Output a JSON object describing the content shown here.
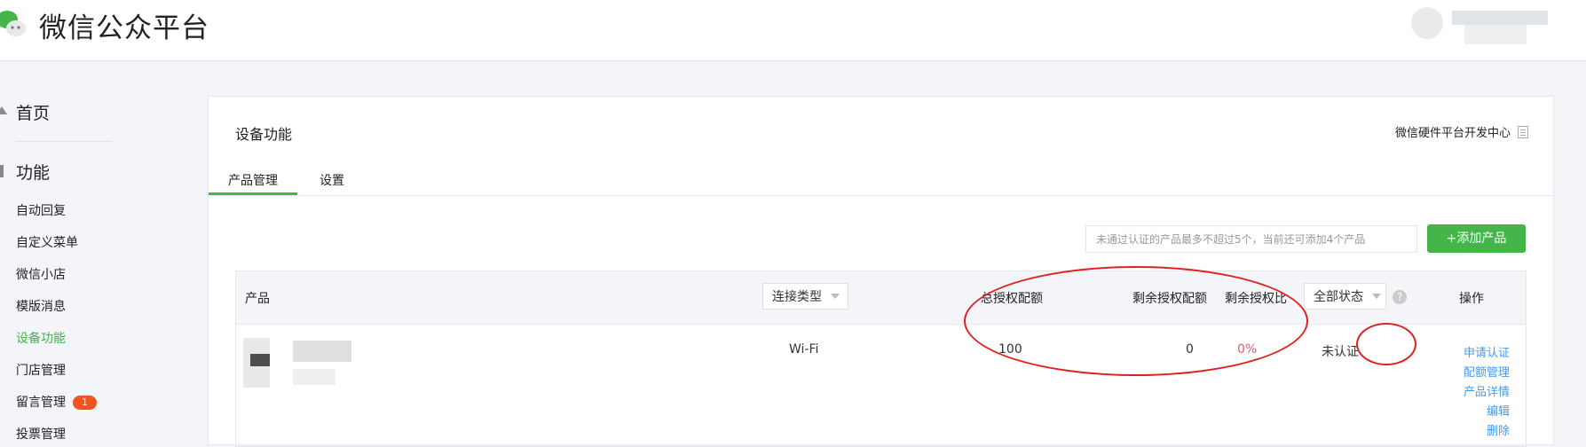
{
  "app": {
    "title": "微信公众平台"
  },
  "sidebar": {
    "home": "首页",
    "section": "功能",
    "items": [
      "自动回复",
      "自定义菜单",
      "微信小店",
      "模版消息",
      "设备功能",
      "门店管理",
      "留言管理",
      "投票管理"
    ],
    "active_item": "设备功能",
    "badge": "1"
  },
  "main": {
    "title": "设备功能",
    "dev_center_link": "微信硬件平台开发中心",
    "tabs": [
      "产品管理",
      "设置"
    ],
    "active_tab": "产品管理",
    "hint": "未通过认证的产品最多不超过5个，当前还可添加4个产品",
    "add_button": "+添加产品"
  },
  "table": {
    "headers": {
      "product": "产品",
      "connect_type": "连接类型",
      "total_quota": "总授权配额",
      "remaining_quota": "剩余授权配额",
      "remaining_ratio": "剩余授权比",
      "status_filter": "全部状态",
      "help": "?",
      "ops": "操作"
    },
    "rows": [
      {
        "connect_type": "Wi-Fi",
        "total_quota": "100",
        "remaining_quota": "0",
        "remaining_ratio": "0%",
        "status": "未认证",
        "actions": [
          "申请认证",
          "配额管理",
          "产品详情",
          "编辑",
          "删除"
        ]
      }
    ]
  },
  "colors": {
    "brand": "#44b549",
    "link": "#459ae9",
    "warning": "#e15f63",
    "badge": "#f0551e",
    "annotation": "#e02020"
  },
  "icons": [
    "wechat-logo-icon",
    "home-arrow-icon",
    "function-icon",
    "document-icon",
    "help-icon",
    "chevron-down-icon"
  ]
}
